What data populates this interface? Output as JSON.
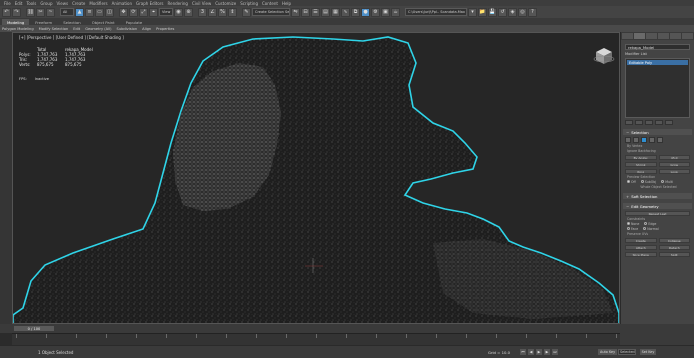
{
  "menu": {
    "items": [
      "File",
      "Edit",
      "Tools",
      "Group",
      "Views",
      "Create",
      "Modifiers",
      "Animation",
      "Graph Editors",
      "Rendering",
      "Civil View",
      "Customize",
      "Scripting",
      "Content",
      "Help"
    ]
  },
  "toolbar": {
    "selection_set_placeholder": "Create Selection Se",
    "workspace_path": "C:\\Users\\Jurij\\Ppl.. Scandata.Max"
  },
  "ribbon": {
    "tabs": [
      "Modeling",
      "Freeform",
      "Selection",
      "Object Paint",
      "Populate"
    ],
    "active_tab": "Modeling",
    "subtabs": [
      "Polygon Modeling",
      "Modify Selection",
      "Edit",
      "Geometry (All)",
      "Subdivision",
      "Align",
      "Properties"
    ]
  },
  "viewport": {
    "label": "[+] [Perspective ] [User Defined ] [Default Shading ]",
    "stats": {
      "header": [
        "Total",
        "rekapa_Model"
      ],
      "rows": [
        {
          "label": "Polys:",
          "total": "1,747,763",
          "object": "1,747,763"
        },
        {
          "label": "Tris:",
          "total": "1,747,763",
          "object": "1,747,763"
        },
        {
          "label": "Verts:",
          "total": "875,675",
          "object": "875,675"
        }
      ]
    },
    "fps_label": "FPS:",
    "fps_value": "Inactive",
    "mesh_outline_color": "#2fd4e8"
  },
  "command_panel": {
    "object_name": "rekapa_Model",
    "modifier_list_label": "Modifier List",
    "stack_item": "Editable Poly",
    "rollouts": {
      "selection": "Selection",
      "soft_selection": "Soft Selection",
      "edit_geometry": "Edit Geometry"
    },
    "selection": {
      "by_vertex": "By Vertex",
      "ignore_backfacing": "Ignore Backfacing",
      "by_angle": "By Angle:",
      "angle_value": "45.0",
      "shrink": "Shrink",
      "grow": "Grow",
      "ring": "Ring",
      "loop": "Loop",
      "preview_label": "Preview Selection",
      "preview_off": "Off",
      "subobj": "SubObj",
      "multi": "Multi",
      "whole_selected": "Whole Object Selected"
    },
    "edit_geometry": {
      "repeat_last": "Repeat Last",
      "constraints": "Constraints",
      "none": "None",
      "edge": "Edge",
      "face": "Face",
      "normal": "Normal",
      "preserve_uvs": "Preserve UVs",
      "create": "Create",
      "collapse": "Collapse",
      "attach": "Attach",
      "detach": "Detach",
      "slice_plane": "Slice Plane",
      "split": "Split"
    }
  },
  "timeline": {
    "slider_label": "0 / 100"
  },
  "status": {
    "selection": "1 Object Selected",
    "grid": "Grid = 10.0",
    "autokey": "Auto Key",
    "selected": "Selected",
    "set_key": "Set Key"
  }
}
